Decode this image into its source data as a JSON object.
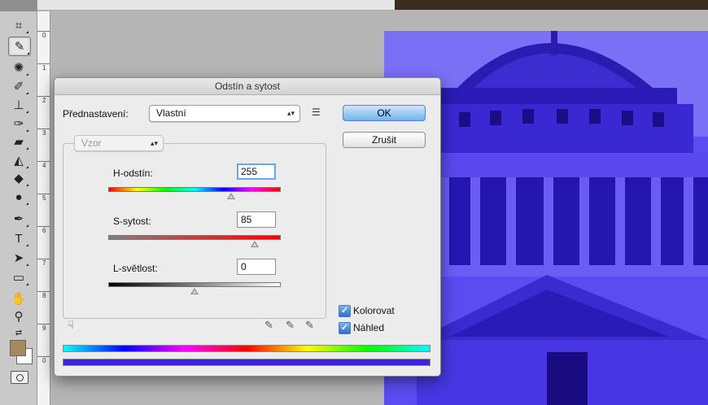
{
  "dialog": {
    "title": "Odstín a sytost",
    "preset_label": "Přednastavení:",
    "preset_value": "Vlastní",
    "preset_options_icon": "preset-options-icon",
    "ok_label": "OK",
    "cancel_label": "Zrušit",
    "channel_value": "Vzor",
    "hue_label": "H-odstín:",
    "hue_value": "255",
    "hue_level": 0.71,
    "saturation_label": "S-sytost:",
    "saturation_value": "85",
    "saturation_level": 0.85,
    "lightness_label": "L-světlost:",
    "lightness_value": "0",
    "lightness_level": 0.5,
    "colorize_label": "Kolorovat",
    "colorize_checked": true,
    "preview_label": "Náhled",
    "preview_checked": true
  },
  "ruler": {
    "ticks": [
      "0",
      "1",
      "2",
      "3",
      "4",
      "5",
      "6",
      "7",
      "8",
      "9",
      "0"
    ]
  },
  "colors": {
    "photo_tint": "#4a38e8",
    "foreground_swatch": "#a68a5d",
    "background_swatch": "#ffffff",
    "result_bar": "#3c24d6"
  }
}
